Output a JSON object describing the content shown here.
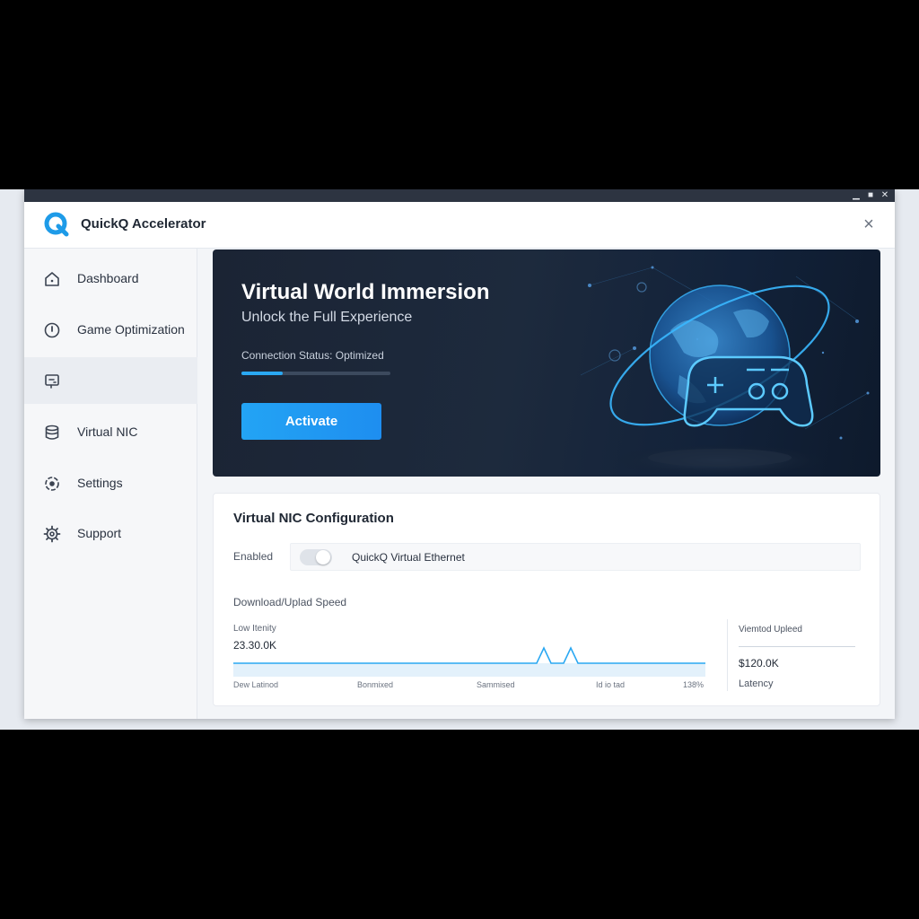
{
  "app": {
    "title": "QuickQ Accelerator"
  },
  "window_controls": {
    "minimize": "▁",
    "maximize": "■",
    "close": "✕"
  },
  "header": {
    "close_icon": "close-icon"
  },
  "sidebar": {
    "items": [
      {
        "label": "Dashboard",
        "icon": "home-icon"
      },
      {
        "label": "Game Optimization",
        "icon": "gauge-icon"
      },
      {
        "label": "",
        "icon": "network-card-icon",
        "active": true
      },
      {
        "label": "Virtual NIC",
        "icon": "database-icon"
      },
      {
        "label": "Settings",
        "icon": "settings-icon"
      },
      {
        "label": "Support",
        "icon": "gear-icon"
      }
    ]
  },
  "hero": {
    "title": "Virtual World Immersion",
    "subtitle": "Unlock the Full Experience",
    "status": "Connection Status: Optimized",
    "progress": 0.28,
    "button": "Activate"
  },
  "nic": {
    "title": "Virtual NIC Configuration",
    "enabled_label": "Enabled",
    "adapter_name": "QuickQ Virtual Ethernet",
    "speed_label": "Download/Uplad Speed",
    "low_label": "Low Itenity",
    "low_value": "23.30.0K",
    "ticks": [
      "Dew Latinod",
      "Bonmixed",
      "Sammised",
      "Id io tad",
      "138%"
    ],
    "stat_label": "Viemtod Upleed",
    "stat_value": "$120.0K",
    "stat_sub": "Latency"
  },
  "colors": {
    "accent": "#2aa8f2",
    "hero_bg": "#1b2434",
    "glow": "#3ab8ff"
  }
}
